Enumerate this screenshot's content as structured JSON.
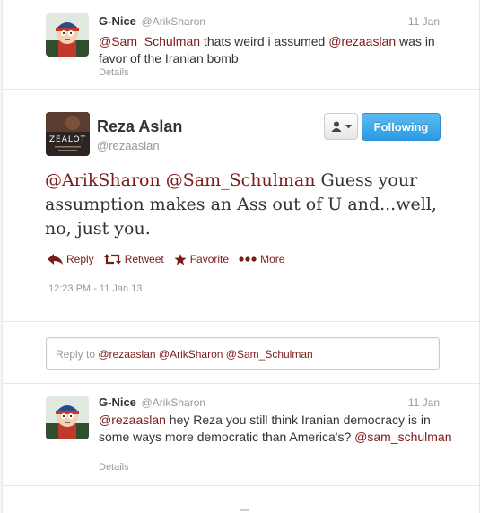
{
  "tweet1": {
    "fullname": "G-Nice",
    "screenname": "@ArikSharon",
    "time": "11 Jan",
    "text_parts": [
      {
        "t": "@Sam_Schulman",
        "mention": true
      },
      {
        "t": " thats weird i assumed ",
        "mention": false
      },
      {
        "t": "@rezaaslan",
        "mention": true
      },
      {
        "t": " was in favor of the Iranian bomb",
        "mention": false
      }
    ],
    "details": "Details"
  },
  "perma": {
    "fullname": "Reza Aslan",
    "screenname": "@rezaaslan",
    "avatar_text": "ZEALOT",
    "follow_label": "Following",
    "text_parts": [
      {
        "t": "@ArikSharon",
        "mention": true
      },
      {
        "t": " ",
        "mention": false
      },
      {
        "t": "@Sam_Schulman",
        "mention": true
      },
      {
        "t": " Guess your assumption makes an Ass out of U and...well, no, just you.",
        "mention": false
      }
    ],
    "actions": {
      "reply": "Reply",
      "retweet": "Retweet",
      "favorite": "Favorite",
      "more": "More"
    },
    "timestamp": "12:23 PM - 11 Jan 13"
  },
  "reply_box": {
    "prefix": "Reply to ",
    "mentions": "@rezaaslan @ArikSharon @Sam_Schulman"
  },
  "tweet3": {
    "fullname": "G-Nice",
    "screenname": "@ArikSharon",
    "time": "11 Jan",
    "text_parts": [
      {
        "t": "@rezaaslan",
        "mention": true
      },
      {
        "t": " hey Reza you still think Iranian democracy is in some ways more democratic than America's? ",
        "mention": false
      },
      {
        "t": "@sam_schulman",
        "mention": true
      }
    ],
    "details": "Details"
  },
  "colors": {
    "link": "#7b1c1c",
    "follow_button": "#2b9ae3",
    "muted": "#999999"
  }
}
